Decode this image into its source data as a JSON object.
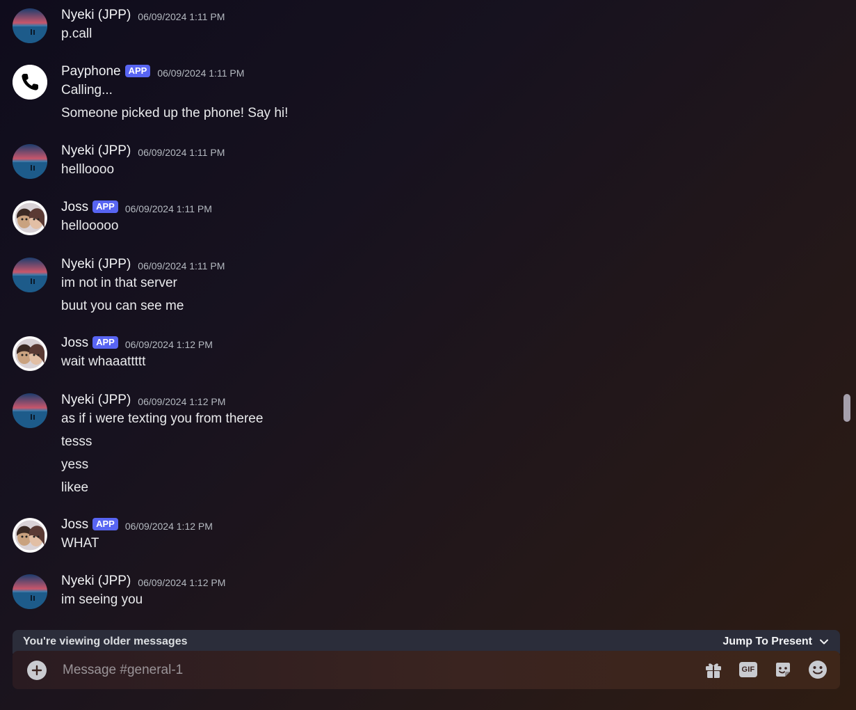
{
  "channel": {
    "placeholder": "Message #general-1"
  },
  "badges": {
    "app": "APP"
  },
  "messages": [
    {
      "user": "Nyeki (JPP)",
      "avatar": "sunset-beach-avatar",
      "time": "06/09/2024 1:11 PM",
      "lines": [
        "p.call"
      ]
    },
    {
      "user": "Payphone",
      "avatar": "phone-avatar",
      "app": true,
      "time": "06/09/2024 1:11 PM",
      "lines": [
        "Calling...",
        "Someone picked up the phone! Say hi!"
      ]
    },
    {
      "user": "Nyeki (JPP)",
      "avatar": "sunset-beach-avatar",
      "time": "06/09/2024 1:11 PM",
      "lines": [
        "hellloooo"
      ]
    },
    {
      "user": "Joss",
      "avatar": "selfie-avatar",
      "app": true,
      "time": "06/09/2024 1:11 PM",
      "lines": [
        "hellooooo"
      ]
    },
    {
      "user": "Nyeki (JPP)",
      "avatar": "sunset-beach-avatar",
      "time": "06/09/2024 1:11 PM",
      "lines": [
        "im not in that server",
        "buut you can see me"
      ]
    },
    {
      "user": "Joss",
      "avatar": "selfie-avatar",
      "app": true,
      "time": "06/09/2024 1:12 PM",
      "lines": [
        "wait whaaattttt"
      ]
    },
    {
      "user": "Nyeki (JPP)",
      "avatar": "sunset-beach-avatar",
      "time": "06/09/2024 1:12 PM",
      "lines": [
        "as if i were texting you from theree",
        "tesss",
        "yess",
        "likee"
      ]
    },
    {
      "user": "Joss",
      "avatar": "selfie-avatar",
      "app": true,
      "time": "06/09/2024 1:12 PM",
      "lines": [
        "WHAT"
      ]
    },
    {
      "user": "Nyeki (JPP)",
      "avatar": "sunset-beach-avatar",
      "time": "06/09/2024 1:12 PM",
      "lines": [
        "im seeing you"
      ]
    }
  ],
  "older_bar": {
    "text": "You're viewing older messages",
    "jump_label": "Jump To Present"
  },
  "composer_icons": [
    "plus-circle-icon",
    "gift-icon",
    "gif-icon",
    "sticker-icon",
    "emoji-icon"
  ],
  "gif_label": "GIF",
  "colors": {
    "app_badge": "#5865f2",
    "timestamp": "#b5bac1",
    "older_bar_bg": "#2b2d3a"
  }
}
